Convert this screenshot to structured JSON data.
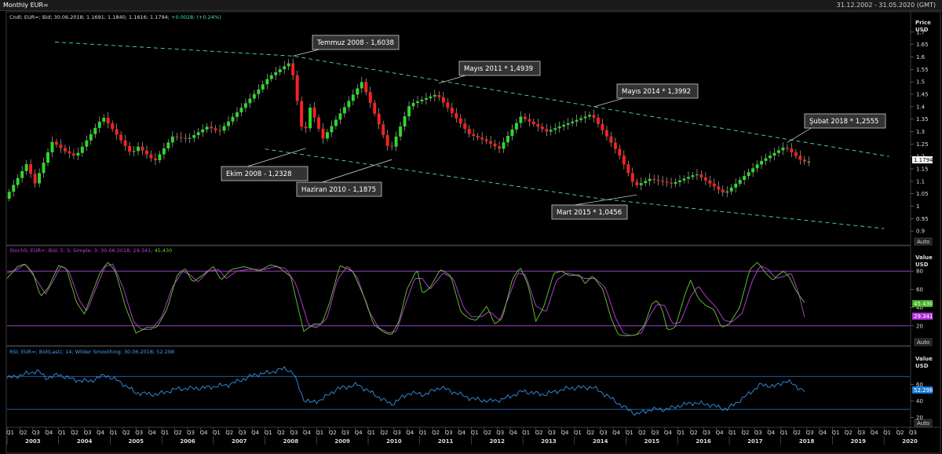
{
  "window": {
    "title": "Monthly EUR=",
    "date_range": "31.12.2002 - 31.05.2020 (GMT)"
  },
  "panels": {
    "price": {
      "header_prefix": "Cndl; EUR=; Bid; 30.06.2018; 1.1691; 1.1840; 1.1616; 1.1794;",
      "header_change": " +0.0028; (+0.24%)",
      "axis_title": "Price",
      "axis_unit": "USD",
      "last_value": "1.1794",
      "auto_label": "Auto"
    },
    "stoch": {
      "header": "StochS; EUR=; Bid;  5;  3; Simple;  3;  30.06.2018; 29.341;",
      "header_value2": " 45.430",
      "axis_title": "Value",
      "axis_unit": "USD",
      "value_k": "45.430",
      "value_d": "29.341",
      "auto_label": "Auto"
    },
    "rsi": {
      "header": "RSI; EUR=; Bid(Last);  14;  Wilder Smoothing;  30.06.2018; 52.298",
      "axis_title": "Value",
      "axis_unit": "USD",
      "value": "52.298",
      "auto_label": "Auto"
    }
  },
  "annotations": [
    {
      "text": "Temmuz 2008 - 1,6038",
      "date": 2008.54,
      "price": 1.6038
    },
    {
      "text": "Ekim 2008 - 1,2328",
      "date": 2008.79,
      "price": 1.2328
    },
    {
      "text": "Haziran 2010 - 1,1875",
      "date": 2010.46,
      "price": 1.1875
    },
    {
      "text": "Mayıs 2011 * 1,4939",
      "date": 2011.37,
      "price": 1.4939
    },
    {
      "text": "Mayıs 2014 * 1,3992",
      "date": 2014.37,
      "price": 1.3992
    },
    {
      "text": "Mart 2015 * 1,0456",
      "date": 2015.21,
      "price": 1.0456
    },
    {
      "text": "Şubat 2018 * 1,2555",
      "date": 2018.12,
      "price": 1.2555
    }
  ],
  "colors": {
    "up": "#2cd82c",
    "down": "#ff2020",
    "trend": "#4fd8c0",
    "stoch_k": "#66cc33",
    "stoch_d": "#c040e0",
    "rsi_line": "#3aa0ff",
    "level_stoch": "#b04ad8",
    "level_rsi": "#2a7cc8"
  },
  "chart_data": [
    {
      "type": "candlestick",
      "title": "Monthly EUR=",
      "ylabel": "Price USD",
      "x_start": 2003.0,
      "x_end": 2020.5,
      "ylim": [
        0.85,
        1.75
      ],
      "yticks": [
        0.9,
        0.95,
        1,
        1.05,
        1.1,
        1.15,
        1.2,
        1.25,
        1.3,
        1.35,
        1.4,
        1.45,
        1.5,
        1.55,
        1.6,
        1.65,
        1.7
      ],
      "anchors": [
        [
          2003.0,
          1.03
        ],
        [
          2003.42,
          1.17
        ],
        [
          2003.58,
          1.09
        ],
        [
          2003.92,
          1.26
        ],
        [
          2004.17,
          1.22
        ],
        [
          2004.37,
          1.2
        ],
        [
          2004.9,
          1.36
        ],
        [
          2005.45,
          1.21
        ],
        [
          2005.58,
          1.24
        ],
        [
          2005.9,
          1.18
        ],
        [
          2006.25,
          1.28
        ],
        [
          2006.55,
          1.27
        ],
        [
          2006.92,
          1.32
        ],
        [
          2007.15,
          1.3
        ],
        [
          2007.92,
          1.47
        ],
        [
          2008.12,
          1.52
        ],
        [
          2008.54,
          1.58
        ],
        [
          2008.79,
          1.27
        ],
        [
          2008.92,
          1.4
        ],
        [
          2009.16,
          1.27
        ],
        [
          2009.92,
          1.5
        ],
        [
          2010.46,
          1.22
        ],
        [
          2010.85,
          1.41
        ],
        [
          2011.37,
          1.45
        ],
        [
          2012.0,
          1.29
        ],
        [
          2012.35,
          1.26
        ],
        [
          2012.58,
          1.23
        ],
        [
          2013.0,
          1.36
        ],
        [
          2013.5,
          1.3
        ],
        [
          2014.37,
          1.37
        ],
        [
          2014.9,
          1.21
        ],
        [
          2015.21,
          1.08
        ],
        [
          2015.5,
          1.11
        ],
        [
          2015.92,
          1.09
        ],
        [
          2016.4,
          1.13
        ],
        [
          2016.95,
          1.05
        ],
        [
          2017.65,
          1.18
        ],
        [
          2018.12,
          1.24
        ],
        [
          2018.46,
          1.1794
        ]
      ],
      "channel_upper": [
        [
          2003.93,
          1.66
        ],
        [
          2008.54,
          1.6038
        ],
        [
          2020.1,
          1.2
        ]
      ],
      "channel_lower": [
        [
          2008.0,
          1.23
        ],
        [
          2014.5,
          1.03
        ],
        [
          2020.0,
          0.91
        ]
      ]
    },
    {
      "type": "line",
      "title": "StochS",
      "series": [
        {
          "name": "StochS %K"
        },
        {
          "name": "StochS %D"
        }
      ],
      "levels": [
        20,
        80
      ],
      "yticks": [
        20,
        40,
        60,
        80
      ],
      "ylim": [
        0,
        100
      ],
      "k_anchors": [
        [
          2003.0,
          72
        ],
        [
          2003.2,
          85
        ],
        [
          2003.35,
          88
        ],
        [
          2003.5,
          78
        ],
        [
          2003.65,
          52
        ],
        [
          2003.8,
          62
        ],
        [
          2004.0,
          86
        ],
        [
          2004.15,
          83
        ],
        [
          2004.35,
          45
        ],
        [
          2004.5,
          33
        ],
        [
          2004.6,
          48
        ],
        [
          2004.8,
          78
        ],
        [
          2004.95,
          90
        ],
        [
          2005.1,
          80
        ],
        [
          2005.3,
          40
        ],
        [
          2005.5,
          12
        ],
        [
          2005.7,
          18
        ],
        [
          2005.9,
          18
        ],
        [
          2006.1,
          38
        ],
        [
          2006.3,
          76
        ],
        [
          2006.45,
          83
        ],
        [
          2006.6,
          68
        ],
        [
          2006.8,
          76
        ],
        [
          2007.0,
          85
        ],
        [
          2007.15,
          70
        ],
        [
          2007.35,
          82
        ],
        [
          2007.6,
          85
        ],
        [
          2007.9,
          80
        ],
        [
          2008.1,
          87
        ],
        [
          2008.25,
          85
        ],
        [
          2008.5,
          74
        ],
        [
          2008.75,
          14
        ],
        [
          2008.95,
          22
        ],
        [
          2009.1,
          22
        ],
        [
          2009.25,
          45
        ],
        [
          2009.45,
          86
        ],
        [
          2009.7,
          80
        ],
        [
          2009.95,
          48
        ],
        [
          2010.1,
          22
        ],
        [
          2010.3,
          13
        ],
        [
          2010.45,
          10
        ],
        [
          2010.6,
          25
        ],
        [
          2010.75,
          60
        ],
        [
          2010.95,
          82
        ],
        [
          2011.05,
          55
        ],
        [
          2011.2,
          62
        ],
        [
          2011.4,
          82
        ],
        [
          2011.6,
          75
        ],
        [
          2011.8,
          35
        ],
        [
          2011.95,
          28
        ],
        [
          2012.1,
          26
        ],
        [
          2012.3,
          42
        ],
        [
          2012.45,
          22
        ],
        [
          2012.6,
          28
        ],
        [
          2012.8,
          72
        ],
        [
          2012.95,
          84
        ],
        [
          2013.1,
          65
        ],
        [
          2013.25,
          25
        ],
        [
          2013.4,
          40
        ],
        [
          2013.6,
          78
        ],
        [
          2013.75,
          80
        ],
        [
          2013.9,
          75
        ],
        [
          2014.1,
          76
        ],
        [
          2014.2,
          66
        ],
        [
          2014.35,
          75
        ],
        [
          2014.55,
          60
        ],
        [
          2014.7,
          30
        ],
        [
          2014.85,
          10
        ],
        [
          2015.0,
          9
        ],
        [
          2015.2,
          10
        ],
        [
          2015.35,
          20
        ],
        [
          2015.5,
          44
        ],
        [
          2015.6,
          48
        ],
        [
          2015.7,
          38
        ],
        [
          2015.8,
          15
        ],
        [
          2015.95,
          18
        ],
        [
          2016.15,
          56
        ],
        [
          2016.25,
          70
        ],
        [
          2016.4,
          50
        ],
        [
          2016.55,
          42
        ],
        [
          2016.7,
          38
        ],
        [
          2016.85,
          18
        ],
        [
          2017.0,
          22
        ],
        [
          2017.2,
          40
        ],
        [
          2017.4,
          82
        ],
        [
          2017.55,
          90
        ],
        [
          2017.7,
          78
        ],
        [
          2017.85,
          70
        ],
        [
          2017.95,
          76
        ],
        [
          2018.05,
          80
        ],
        [
          2018.15,
          75
        ],
        [
          2018.3,
          58
        ],
        [
          2018.46,
          45.43
        ]
      ],
      "d_anchors": [
        [
          2003.0,
          78
        ],
        [
          2003.2,
          82
        ],
        [
          2003.35,
          88
        ],
        [
          2003.55,
          72
        ],
        [
          2003.75,
          55
        ],
        [
          2003.9,
          70
        ],
        [
          2004.05,
          86
        ],
        [
          2004.2,
          80
        ],
        [
          2004.4,
          48
        ],
        [
          2004.55,
          36
        ],
        [
          2004.7,
          58
        ],
        [
          2004.9,
          85
        ],
        [
          2005.05,
          88
        ],
        [
          2005.25,
          62
        ],
        [
          2005.45,
          25
        ],
        [
          2005.6,
          16
        ],
        [
          2005.8,
          16
        ],
        [
          2006.0,
          30
        ],
        [
          2006.2,
          62
        ],
        [
          2006.4,
          80
        ],
        [
          2006.55,
          76
        ],
        [
          2006.7,
          68
        ],
        [
          2006.9,
          80
        ],
        [
          2007.1,
          82
        ],
        [
          2007.25,
          72
        ],
        [
          2007.45,
          80
        ],
        [
          2007.7,
          82
        ],
        [
          2008.0,
          82
        ],
        [
          2008.2,
          85
        ],
        [
          2008.4,
          83
        ],
        [
          2008.6,
          66
        ],
        [
          2008.85,
          20
        ],
        [
          2009.0,
          18
        ],
        [
          2009.2,
          28
        ],
        [
          2009.4,
          70
        ],
        [
          2009.6,
          86
        ],
        [
          2009.8,
          72
        ],
        [
          2010.0,
          38
        ],
        [
          2010.2,
          18
        ],
        [
          2010.4,
          12
        ],
        [
          2010.55,
          14
        ],
        [
          2010.7,
          40
        ],
        [
          2010.9,
          72
        ],
        [
          2011.05,
          72
        ],
        [
          2011.2,
          60
        ],
        [
          2011.45,
          78
        ],
        [
          2011.65,
          72
        ],
        [
          2011.85,
          40
        ],
        [
          2012.0,
          30
        ],
        [
          2012.2,
          30
        ],
        [
          2012.35,
          36
        ],
        [
          2012.55,
          26
        ],
        [
          2012.7,
          48
        ],
        [
          2012.9,
          78
        ],
        [
          2013.05,
          76
        ],
        [
          2013.25,
          42
        ],
        [
          2013.45,
          35
        ],
        [
          2013.65,
          70
        ],
        [
          2013.85,
          78
        ],
        [
          2014.0,
          76
        ],
        [
          2014.2,
          72
        ],
        [
          2014.4,
          72
        ],
        [
          2014.6,
          62
        ],
        [
          2014.8,
          28
        ],
        [
          2014.95,
          12
        ],
        [
          2015.1,
          9
        ],
        [
          2015.3,
          12
        ],
        [
          2015.45,
          30
        ],
        [
          2015.6,
          44
        ],
        [
          2015.75,
          42
        ],
        [
          2015.9,
          22
        ],
        [
          2016.05,
          24
        ],
        [
          2016.25,
          52
        ],
        [
          2016.4,
          64
        ],
        [
          2016.55,
          52
        ],
        [
          2016.75,
          40
        ],
        [
          2016.9,
          26
        ],
        [
          2017.05,
          24
        ],
        [
          2017.25,
          34
        ],
        [
          2017.45,
          70
        ],
        [
          2017.6,
          86
        ],
        [
          2017.75,
          82
        ],
        [
          2017.9,
          72
        ],
        [
          2018.05,
          74
        ],
        [
          2018.2,
          78
        ],
        [
          2018.35,
          55
        ],
        [
          2018.46,
          29.341
        ]
      ]
    },
    {
      "type": "line",
      "title": "RSI",
      "series": [
        {
          "name": "RSI 14"
        }
      ],
      "levels": [
        30,
        70
      ],
      "yticks": [
        20,
        40,
        60
      ],
      "ylim": [
        10,
        98
      ],
      "anchors": [
        [
          2003.0,
          68
        ],
        [
          2003.3,
          72
        ],
        [
          2003.6,
          77
        ],
        [
          2003.75,
          68
        ],
        [
          2004.0,
          72
        ],
        [
          2004.3,
          66
        ],
        [
          2004.6,
          64
        ],
        [
          2004.9,
          72
        ],
        [
          2005.2,
          63
        ],
        [
          2005.5,
          50
        ],
        [
          2005.9,
          48
        ],
        [
          2006.3,
          55
        ],
        [
          2006.8,
          56
        ],
        [
          2007.3,
          60
        ],
        [
          2007.8,
          72
        ],
        [
          2008.1,
          75
        ],
        [
          2008.4,
          80
        ],
        [
          2008.55,
          74
        ],
        [
          2008.75,
          42
        ],
        [
          2008.9,
          38
        ],
        [
          2009.1,
          42
        ],
        [
          2009.4,
          55
        ],
        [
          2009.8,
          60
        ],
        [
          2010.2,
          45
        ],
        [
          2010.45,
          36
        ],
        [
          2010.8,
          50
        ],
        [
          2011.1,
          48
        ],
        [
          2011.4,
          57
        ],
        [
          2011.7,
          50
        ],
        [
          2012.0,
          43
        ],
        [
          2012.35,
          40
        ],
        [
          2012.6,
          42
        ],
        [
          2013.0,
          52
        ],
        [
          2013.4,
          48
        ],
        [
          2013.9,
          56
        ],
        [
          2014.35,
          57
        ],
        [
          2014.6,
          48
        ],
        [
          2014.9,
          35
        ],
        [
          2015.2,
          24
        ],
        [
          2015.5,
          30
        ],
        [
          2015.8,
          30
        ],
        [
          2016.0,
          34
        ],
        [
          2016.3,
          38
        ],
        [
          2016.6,
          36
        ],
        [
          2016.95,
          30
        ],
        [
          2017.3,
          45
        ],
        [
          2017.6,
          60
        ],
        [
          2017.9,
          58
        ],
        [
          2018.1,
          65
        ],
        [
          2018.3,
          58
        ],
        [
          2018.46,
          52.298
        ]
      ]
    }
  ],
  "x_axis": {
    "quarters": [
      "Q1",
      "Q2",
      "Q3",
      "Q4"
    ],
    "years": [
      "2003",
      "2004",
      "2005",
      "2006",
      "2007",
      "2008",
      "2009",
      "2010",
      "2011",
      "2012",
      "2013",
      "2014",
      "2015",
      "2016",
      "2017",
      "2018",
      "2019",
      "2020"
    ]
  }
}
